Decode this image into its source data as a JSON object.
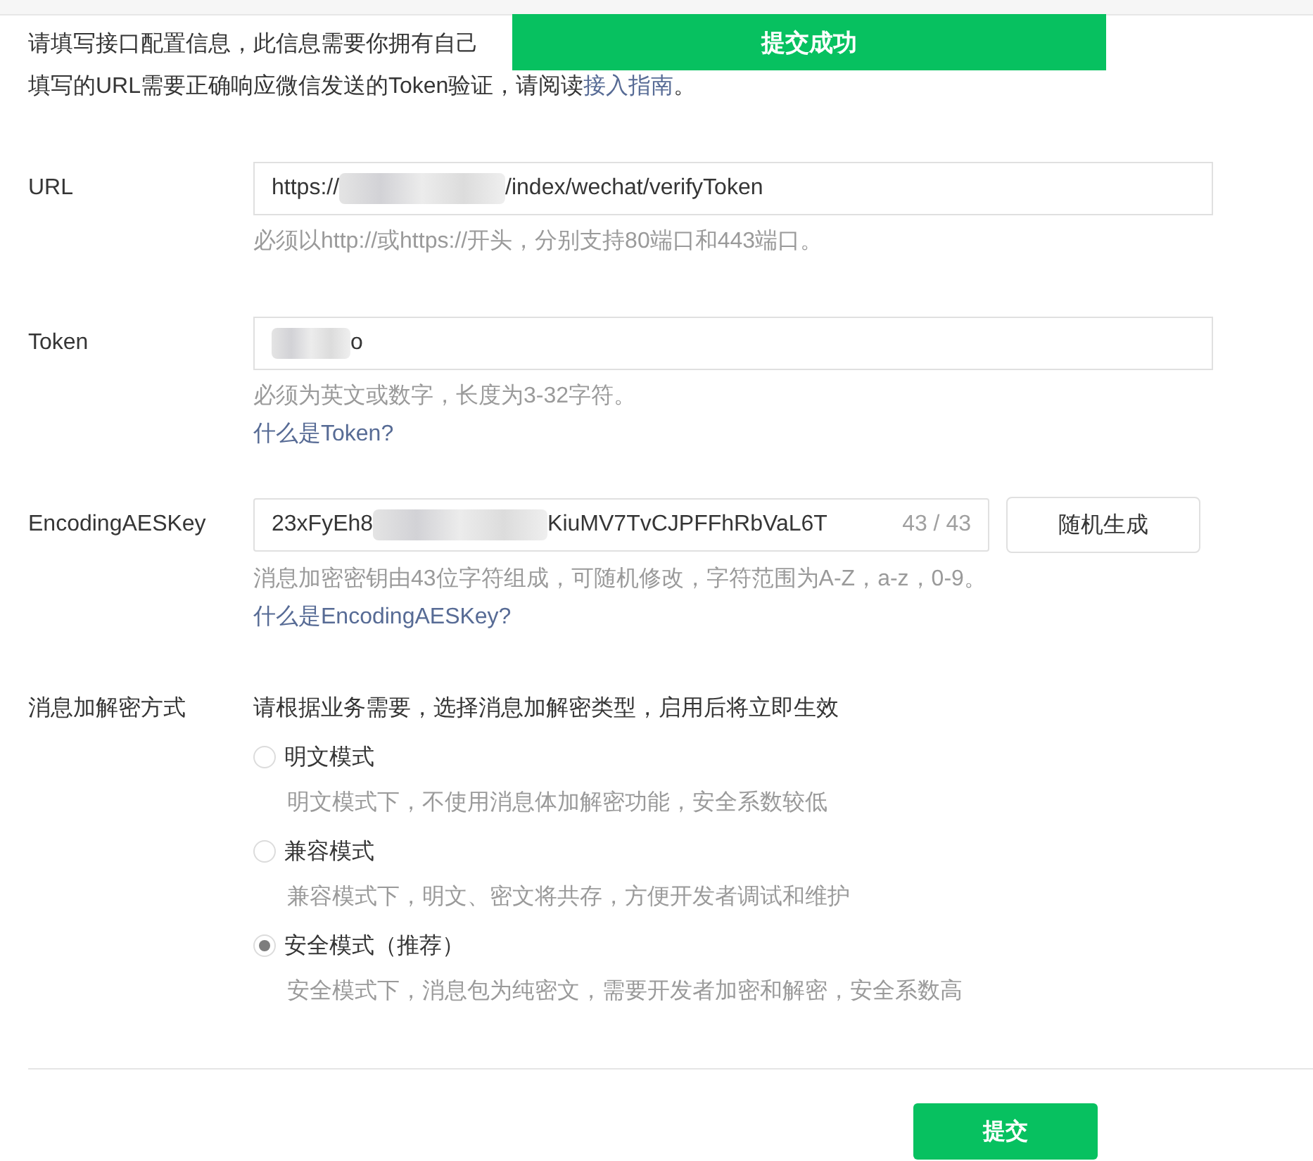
{
  "toast": {
    "text": "提交成功"
  },
  "intro": {
    "line_1": "请填写接口配置信息，此信息需要你拥有自己",
    "line_2_before": "填写的URL需要正确响应微信发送的Token验证，请阅读",
    "line_2_link": "接入指南",
    "line_2_after": "。"
  },
  "url": {
    "label": "URL",
    "value_before": "https://",
    "value_after": "/index/wechat/verifyToken",
    "hint": "必须以http://或https://开头，分别支持80端口和443端口。"
  },
  "token": {
    "label": "Token",
    "value_after": "o",
    "hint": "必须为英文或数字，长度为3-32字符。",
    "help_link": "什么是Token?"
  },
  "aes_key": {
    "label": "EncodingAESKey",
    "value_before": "23xFyEh8",
    "value_after": "KiuMV7TvCJPFFhRbVaL6T",
    "counter": "43 / 43",
    "generate_button": "随机生成",
    "hint": "消息加密密钥由43位字符组成，可随机修改，字符范围为A-Z，a-z，0-9。",
    "help_link": "什么是EncodingAESKey?"
  },
  "encryption": {
    "label": "消息加解密方式",
    "description": "请根据业务需要，选择消息加解密类型，启用后将立即生效",
    "options": [
      {
        "label": "明文模式",
        "note": "明文模式下，不使用消息体加解密功能，安全系数较低",
        "selected": false
      },
      {
        "label": "兼容模式",
        "note": "兼容模式下，明文、密文将共存，方便开发者调试和维护",
        "selected": false
      },
      {
        "label": "安全模式（推荐）",
        "note": "安全模式下，消息包为纯密文，需要开发者加密和解密，安全系数高",
        "selected": true
      }
    ]
  },
  "submit_button": "提交"
}
